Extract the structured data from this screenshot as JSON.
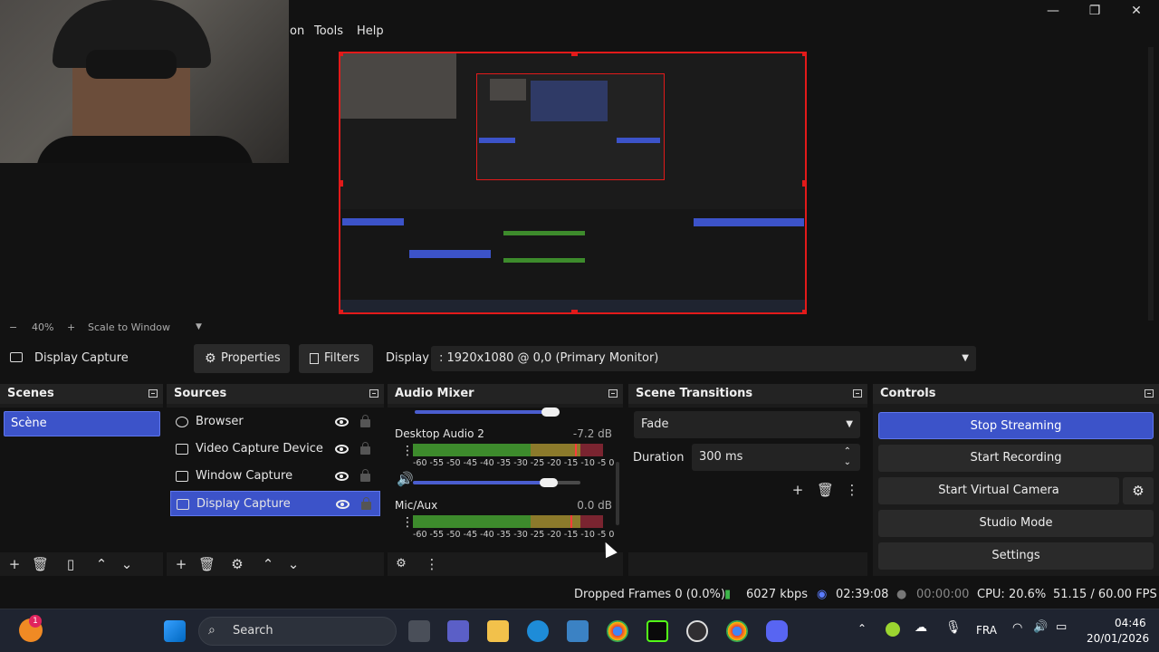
{
  "menu": {
    "items": [
      "on",
      "Tools",
      "Help"
    ]
  },
  "window_controls": {
    "minimize": "—",
    "maximize": "❐",
    "close": "✕"
  },
  "preview": {
    "zoom_minus": "−",
    "zoom_level": "40%",
    "zoom_plus": "+",
    "scale_mode": "Scale to Window"
  },
  "context_bar": {
    "source_name": "Display Capture",
    "properties_label": "Properties",
    "filters_label": "Filters",
    "display_label": "Display",
    "display_value": ": 1920x1080 @ 0,0 (Primary Monitor)"
  },
  "scenes": {
    "title": "Scenes",
    "items": [
      {
        "label": "Scène",
        "selected": true
      }
    ]
  },
  "sources": {
    "title": "Sources",
    "items": [
      {
        "label": "Browser",
        "icon": "globe-icon",
        "selected": false
      },
      {
        "label": "Video Capture Device",
        "icon": "camera-icon",
        "selected": false
      },
      {
        "label": "Window Capture",
        "icon": "window-icon",
        "selected": false
      },
      {
        "label": "Display Capture",
        "icon": "monitor-icon",
        "selected": true
      }
    ]
  },
  "audio_mixer": {
    "title": "Audio Mixer",
    "channels": [
      {
        "name": "Desktop Audio 2",
        "db": "-7.2 dB",
        "ticks": "-60 -55 -50 -45 -40 -35 -30 -25 -20 -15 -10 -5 0",
        "level": 0.85
      },
      {
        "name": "Mic/Aux",
        "db": "0.0 dB",
        "ticks": "-60 -55 -50 -45 -40 -35 -30 -25 -20 -15 -10 -5 0",
        "level": 0.83
      }
    ]
  },
  "scene_transitions": {
    "title": "Scene Transitions",
    "transition": "Fade",
    "duration_label": "Duration",
    "duration_value": "300 ms"
  },
  "controls": {
    "title": "Controls",
    "stop_streaming": "Stop Streaming",
    "start_recording": "Start Recording",
    "start_virtual_camera": "Start Virtual Camera",
    "studio_mode": "Studio Mode",
    "settings": "Settings"
  },
  "status_bar": {
    "dropped_frames": "Dropped Frames 0 (0.0%)",
    "bitrate": "6027 kbps",
    "stream_time": "02:39:08",
    "record_time": "00:00:00",
    "cpu": "CPU: 20.6%",
    "fps": "51.15 / 60.00 FPS"
  },
  "taskbar": {
    "search_placeholder": "Search",
    "language": "FRA",
    "time": "04:46",
    "date": "20/01/2026",
    "notification_badge": "1"
  },
  "colors": {
    "accent": "#3c53c9",
    "selection_border": "#e21a1a",
    "background": "#121212",
    "panel": "#1b1b1b"
  }
}
